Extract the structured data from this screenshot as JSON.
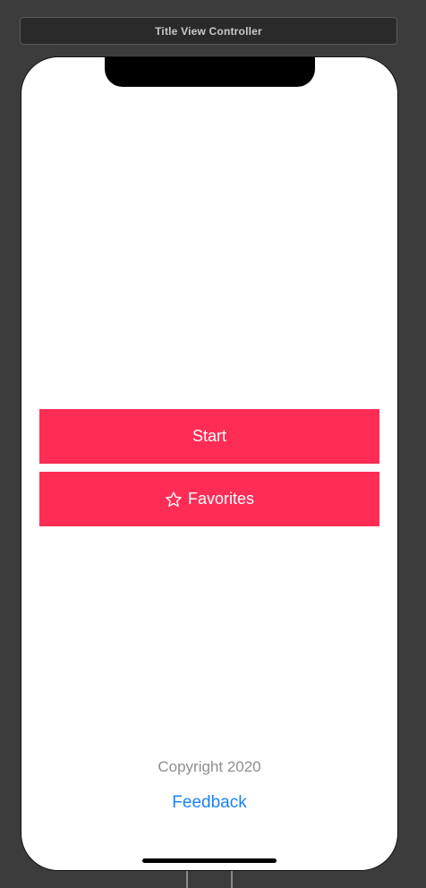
{
  "storyboard": {
    "scene_title": "Title View Controller"
  },
  "screen": {
    "start_button": {
      "label": "Start"
    },
    "favorites_button": {
      "label": "Favorites",
      "icon": "star-outline-icon"
    },
    "copyright": "Copyright 2020",
    "feedback_link": "Feedback"
  },
  "colors": {
    "accent_button": "#ff2d55",
    "link": "#1a82f7",
    "secondary_text": "#8e8e93",
    "canvas_background": "#3c3c3c"
  }
}
